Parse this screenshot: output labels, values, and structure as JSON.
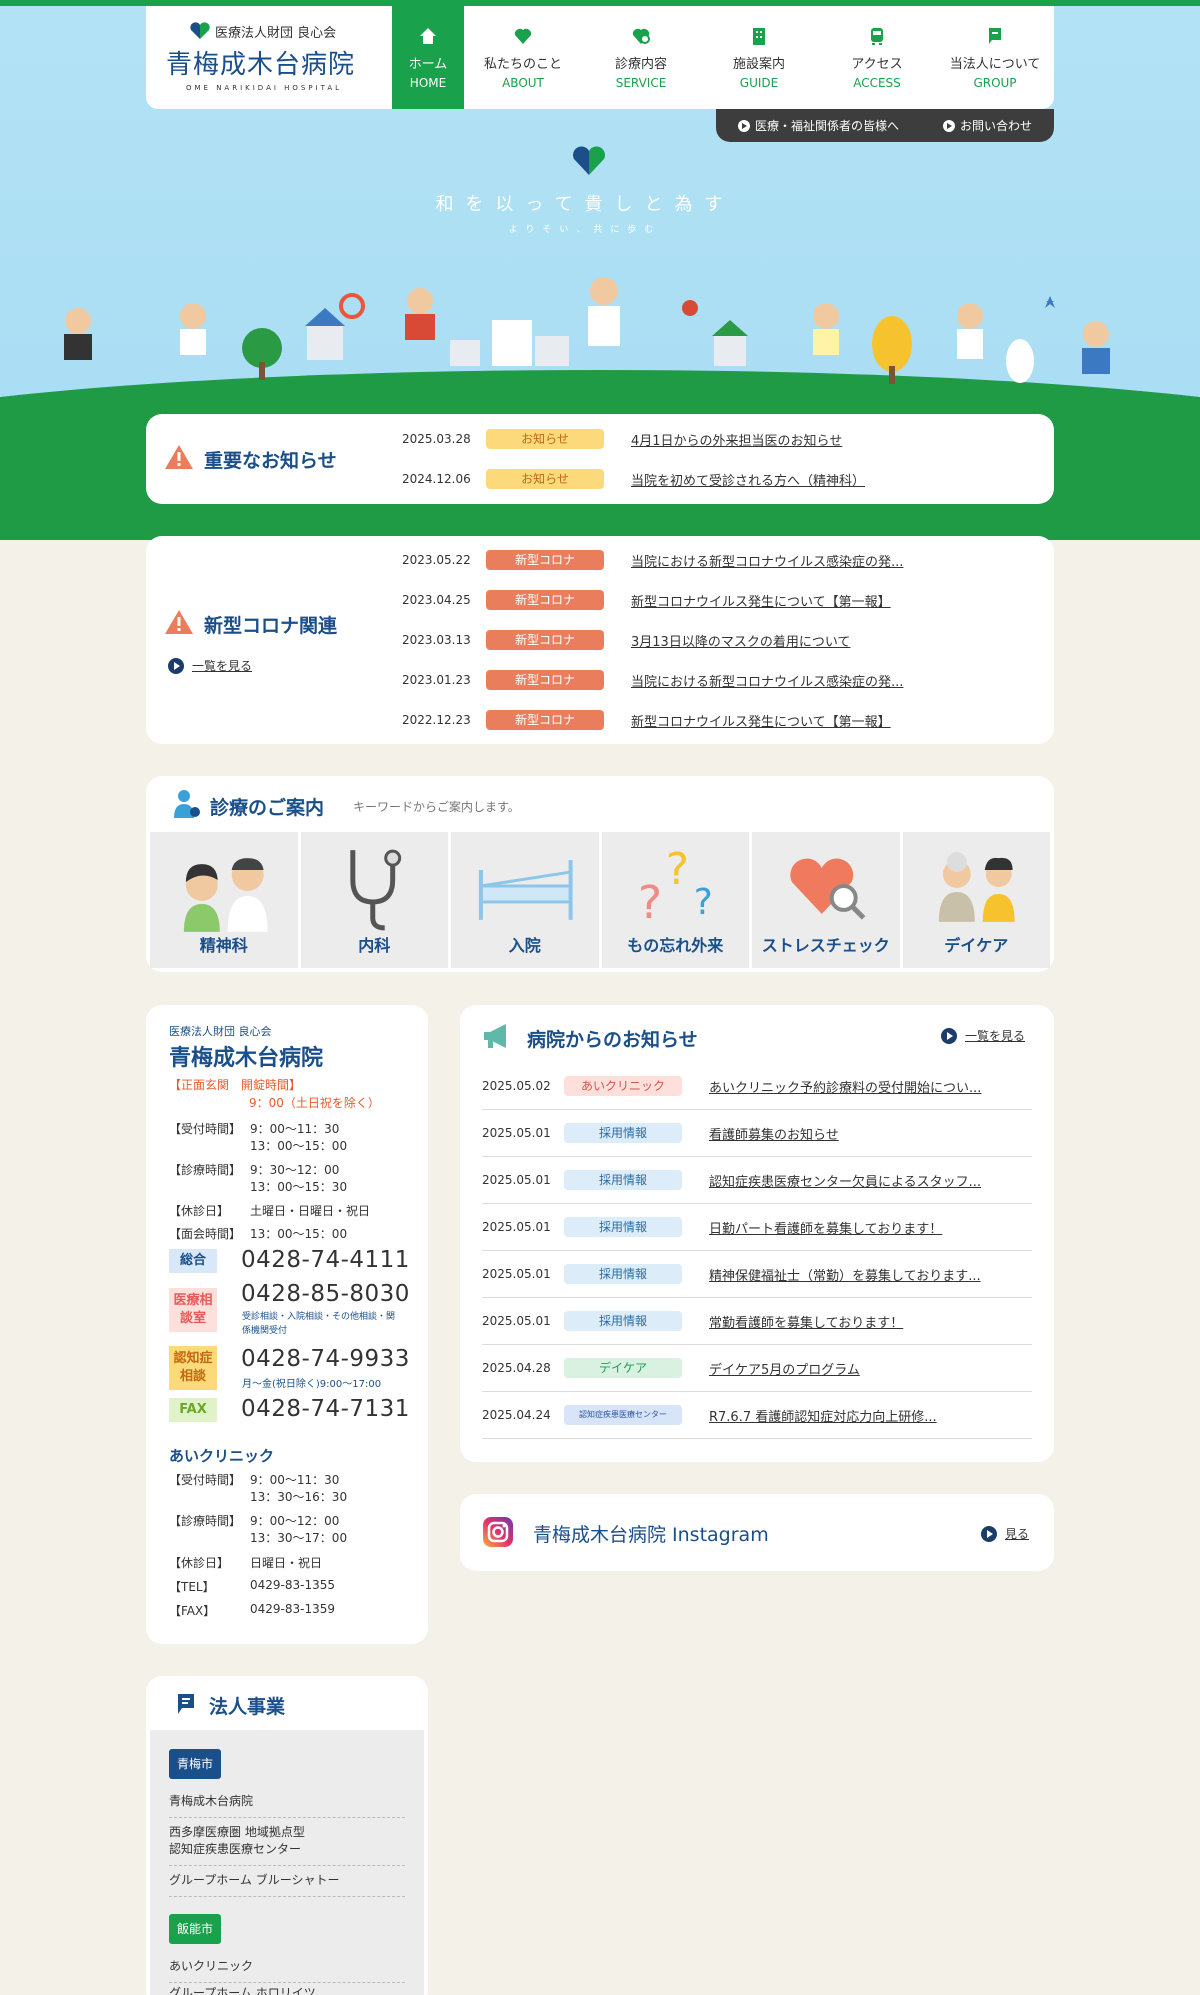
{
  "header": {
    "org": "医療法人財団 良心会",
    "hospital": "青梅成木台病院",
    "hospital_en": "OME NARIKIDAI HOSPITAL",
    "nav": [
      {
        "ja": "ホーム",
        "en": "HOME",
        "icon": "home-icon"
      },
      {
        "ja": "私たちのこと",
        "en": "ABOUT",
        "icon": "heart-icon"
      },
      {
        "ja": "診療内容",
        "en": "SERVICE",
        "icon": "stethoscope-icon"
      },
      {
        "ja": "施設案内",
        "en": "GUIDE",
        "icon": "building-icon"
      },
      {
        "ja": "アクセス",
        "en": "ACCESS",
        "icon": "train-icon"
      },
      {
        "ja": "当法人について",
        "en": "GROUP",
        "icon": "flag-icon"
      }
    ],
    "subnav": [
      "医療・福祉関係者の皆様へ",
      "お問い合わせ"
    ],
    "brand_color": "#1aa14b"
  },
  "hero": {
    "slogan": "和を以って貴しと為す",
    "slogan_sub": "よりそい、共に歩む"
  },
  "important": {
    "title": "重要なお知らせ",
    "items": [
      {
        "date": "2025.03.28",
        "tag": "お知らせ",
        "text": "4月1日からの外来担当医のお知らせ"
      },
      {
        "date": "2024.12.06",
        "tag": "お知らせ",
        "text": "当院を初めて受診される方へ（精神科）"
      }
    ]
  },
  "covid": {
    "title": "新型コロナ関連",
    "more": "一覧を見る",
    "items": [
      {
        "date": "2023.05.22",
        "tag": "新型コロナ",
        "text": "当院における新型コロナウイルス感染症の発..."
      },
      {
        "date": "2023.04.25",
        "tag": "新型コロナ",
        "text": "新型コロナウイルス発生について【第一報】"
      },
      {
        "date": "2023.03.13",
        "tag": "新型コロナ",
        "text": "3月13日以降のマスクの着用について"
      },
      {
        "date": "2023.01.23",
        "tag": "新型コロナ",
        "text": "当院における新型コロナウイルス感染症の発..."
      },
      {
        "date": "2022.12.23",
        "tag": "新型コロナ",
        "text": "新型コロナウイルス発生について【第一報】"
      }
    ]
  },
  "departments": {
    "title": "診療のご案内",
    "sub": "キーワードからご案内します。",
    "items": [
      "精神科",
      "内科",
      "入院",
      "もの忘れ外来",
      "ストレスチェック",
      "デイケア"
    ]
  },
  "info": {
    "org": "医療法人財団 良心会",
    "hospital": "青梅成木台病院",
    "entrance_label": "【正面玄関　開錠時間】",
    "entrance_time": "9：00（土日祝を除く）",
    "rows": [
      {
        "k": "【受付時間】",
        "v1": "9：00〜11：30",
        "v2": "13：00〜15：00"
      },
      {
        "k": "【診療時間】",
        "v1": "9：30〜12：00",
        "v2": "13：00〜15：30"
      },
      {
        "k": "【休診日】",
        "v1": "土曜日・日曜日・祝日",
        "v2": ""
      },
      {
        "k": "【面会時間】",
        "v1": "13：00〜15：00",
        "v2": ""
      }
    ],
    "phones": [
      {
        "tag": "総合",
        "number": "0428-74-4111",
        "note": ""
      },
      {
        "tag": "医療相談室",
        "number": "0428-85-8030",
        "note": "受診相談・入院相談・その他相談・関係機関受付"
      },
      {
        "tag": "認知症相談",
        "number": "0428-74-9933",
        "note": "月〜金(祝日除く)9:00〜17:00"
      },
      {
        "tag": "FAX",
        "number": "0428-74-7131",
        "note": ""
      }
    ],
    "clinic": {
      "name": "あいクリニック",
      "rows": [
        {
          "k": "【受付時間】",
          "v1": "9：00〜11：30",
          "v2": "13：30〜16：30"
        },
        {
          "k": "【診療時間】",
          "v1": "9：00〜12：00",
          "v2": "13：30〜17：00"
        },
        {
          "k": "【休診日】",
          "v1": "日曜日・祝日",
          "v2": ""
        },
        {
          "k": "【TEL】",
          "v1": "0429-83-1355",
          "v2": ""
        },
        {
          "k": "【FAX】",
          "v1": "0429-83-1359",
          "v2": ""
        }
      ]
    }
  },
  "news": {
    "title": "病院からのお知らせ",
    "more": "一覧を見る",
    "items": [
      {
        "date": "2025.05.02",
        "tag": "あいクリニック",
        "kind": "ai",
        "text": "あいクリニック予約診療料の受付開始につい..."
      },
      {
        "date": "2025.05.01",
        "tag": "採用情報",
        "kind": "job",
        "text": "看護師募集のお知らせ"
      },
      {
        "date": "2025.05.01",
        "tag": "採用情報",
        "kind": "job",
        "text": "認知症疾患医療センター欠員によるスタッフ..."
      },
      {
        "date": "2025.05.01",
        "tag": "採用情報",
        "kind": "job",
        "text": "日勤パート看護師を募集しております！"
      },
      {
        "date": "2025.05.01",
        "tag": "採用情報",
        "kind": "job",
        "text": "精神保健福祉士（常勤）を募集しております..."
      },
      {
        "date": "2025.05.01",
        "tag": "採用情報",
        "kind": "job",
        "text": "常勤看護師を募集しております！"
      },
      {
        "date": "2025.04.28",
        "tag": "デイケア",
        "kind": "dc",
        "text": "デイケア5月のプログラム"
      },
      {
        "date": "2025.04.24",
        "tag": "認知症疾患医療センター",
        "kind": "cen",
        "text": "R7.6.7 看護師認知症対応力向上研修..."
      }
    ]
  },
  "instagram": {
    "title": "青梅成木台病院 Instagram",
    "link": "見る"
  },
  "corp": {
    "title": "法人事業",
    "groups": [
      {
        "city": "青梅市",
        "items": [
          "青梅成木台病院",
          "西多摩医療圏 地域拠点型\n認知症疾患医療センター",
          "グループホーム ブルーシャトー"
        ]
      },
      {
        "city": "飯能市",
        "items": [
          "あいクリニック",
          "グループホーム ホロリイツ"
        ]
      }
    ]
  }
}
